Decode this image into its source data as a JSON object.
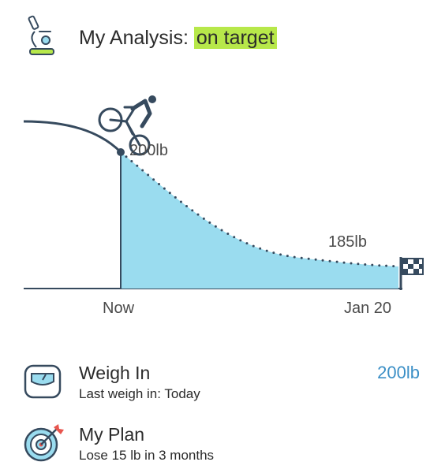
{
  "header": {
    "icon": "microscope-icon",
    "title_prefix": "My Analysis: ",
    "status": "on target",
    "status_color": "#b7e84a"
  },
  "chart_data": {
    "type": "area",
    "x_labels": [
      "Now",
      "Jan 20"
    ],
    "annotations": [
      "200lb",
      "185lb"
    ],
    "start_weight_lb": 200,
    "target_weight_lb": 185,
    "icons": [
      "cyclist-icon",
      "finish-flag-icon"
    ],
    "fill_color": "#9adcef",
    "line_color": "#364a5e"
  },
  "weigh_in": {
    "icon": "scale-icon",
    "title": "Weigh In",
    "subtitle": "Last weigh in: Today",
    "value": "200lb",
    "value_color": "#3b8fc6"
  },
  "plan": {
    "icon": "target-icon",
    "title": "My Plan",
    "subtitle": "Lose 15 lb in 3 months"
  }
}
